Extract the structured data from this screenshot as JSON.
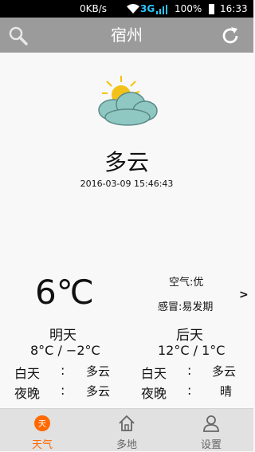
{
  "status_bar": {
    "net_speed": "0KB/s",
    "network": "3G",
    "battery": "100%",
    "time": "16:33"
  },
  "header": {
    "city": "宿州"
  },
  "weather": {
    "description": "多云",
    "datetime": "2016-03-09 15:46:43",
    "temperature": "6℃",
    "air_quality": "空气:优",
    "cold_index": "感冒:易发期",
    "more_arrow": ">"
  },
  "forecast": [
    {
      "title": "明天",
      "range": "8°C / −2°C",
      "day_label": "白天",
      "day_colon": ":",
      "day_value": "多云",
      "night_label": "夜晚",
      "night_colon": ":",
      "night_value": "多云"
    },
    {
      "title": "后天",
      "range": "12°C / 1°C",
      "day_label": "白天",
      "day_colon": ":",
      "day_value": "多云",
      "night_label": "夜晚",
      "night_colon": ":",
      "night_value": "晴"
    }
  ],
  "tabs": [
    {
      "label": "天气",
      "icon": "weather-icon",
      "icon_char": "天"
    },
    {
      "label": "多地",
      "icon": "home-icon"
    },
    {
      "label": "设置",
      "icon": "user-icon"
    }
  ],
  "colors": {
    "header": "#9b9b9b",
    "accent": "#ff6a00",
    "tabbar": "#e1e1e1"
  }
}
